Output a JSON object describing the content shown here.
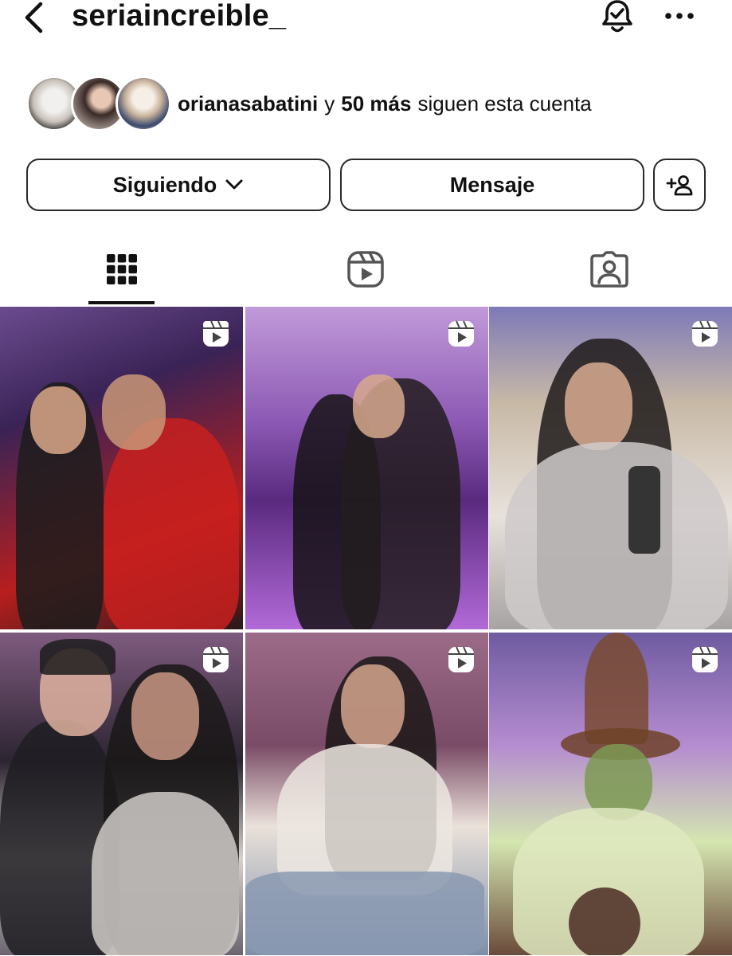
{
  "header": {
    "username": "seriaincreible_",
    "icons": [
      "back-chevron-icon",
      "bell-check-icon",
      "more-horizontal-icon"
    ]
  },
  "followed_by": {
    "primary": "orianasabatini",
    "connector": "y",
    "count": "50 más",
    "suffix": "siguen esta cuenta"
  },
  "actions": {
    "following_label": "Siguiendo",
    "message_label": "Mensaje",
    "add_user_icon": "add-person-icon"
  },
  "tabs": [
    {
      "icon": "grid-icon",
      "selected": true
    },
    {
      "icon": "reels-icon",
      "selected": false
    },
    {
      "icon": "tagged-icon",
      "selected": false
    }
  ],
  "posts": [
    {
      "type": "reel",
      "icon": "reel-icon"
    },
    {
      "type": "reel",
      "icon": "reel-icon"
    },
    {
      "type": "reel",
      "icon": "reel-icon"
    },
    {
      "type": "reel",
      "icon": "reel-icon"
    },
    {
      "type": "reel",
      "icon": "reel-icon"
    },
    {
      "type": "reel",
      "icon": "reel-icon"
    }
  ],
  "colors": {
    "text": "#111111",
    "border": "#2a2a2a",
    "background": "#ffffff"
  }
}
